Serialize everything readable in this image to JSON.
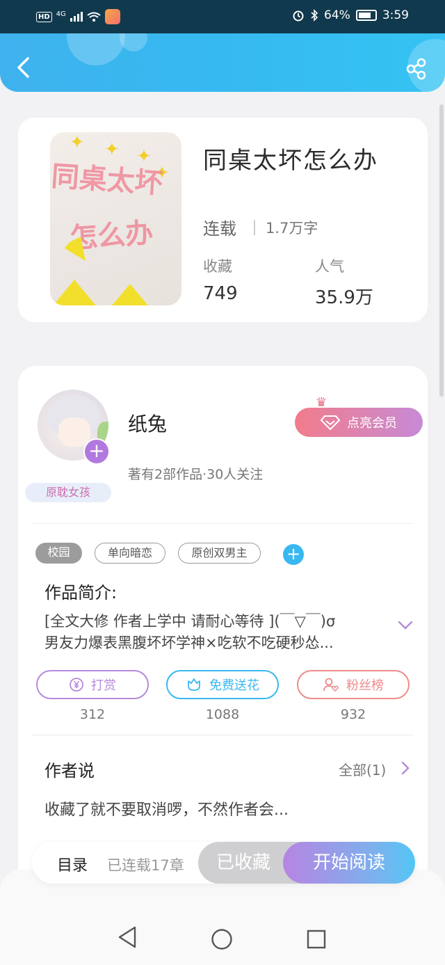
{
  "status_bar": {
    "network": "4G",
    "hd": "HD",
    "battery_percent": "64%",
    "time": "3:59"
  },
  "book": {
    "title": "同桌太坏怎么办",
    "cover_text_line1": "同桌太坏",
    "cover_text_line2": "怎么办",
    "status": "连载",
    "word_count": "1.7万字",
    "favorites_label": "收藏",
    "favorites_value": "749",
    "popularity_label": "人气",
    "popularity_value": "35.9万"
  },
  "author": {
    "name": "纸兔",
    "meta": "著有2部作品·30人关注",
    "badge": "原耽女孩",
    "vip_label": "点亮会员"
  },
  "tags": [
    "校园",
    "单向暗恋",
    "原创双男主"
  ],
  "intro": {
    "title": "作品简介:",
    "line1": "[全文大修 作者上学中 请耐心等待 ](￣▽￣)σ",
    "line2": "男友力爆表黑腹坏坏学神×吃软不吃硬秒怂..."
  },
  "actions": [
    {
      "label": "打赏",
      "count": "312",
      "color": "#b58ad8"
    },
    {
      "label": "免费送花",
      "count": "1088",
      "color": "#39b8f0"
    },
    {
      "label": "粉丝榜",
      "count": "932",
      "color": "#ef8a8a"
    }
  ],
  "author_says": {
    "title": "作者说",
    "all_label": "全部(1)",
    "text": "收藏了就不要取消啰，不然作者会..."
  },
  "bottom_bar": {
    "toc_label": "目录",
    "chapters_label": "已连载17章",
    "collected_label": "已收藏",
    "read_label": "开始阅读"
  },
  "colors": {
    "header": "#36b9f0",
    "accent_purple": "#b178de",
    "accent_blue": "#39b8f0"
  }
}
